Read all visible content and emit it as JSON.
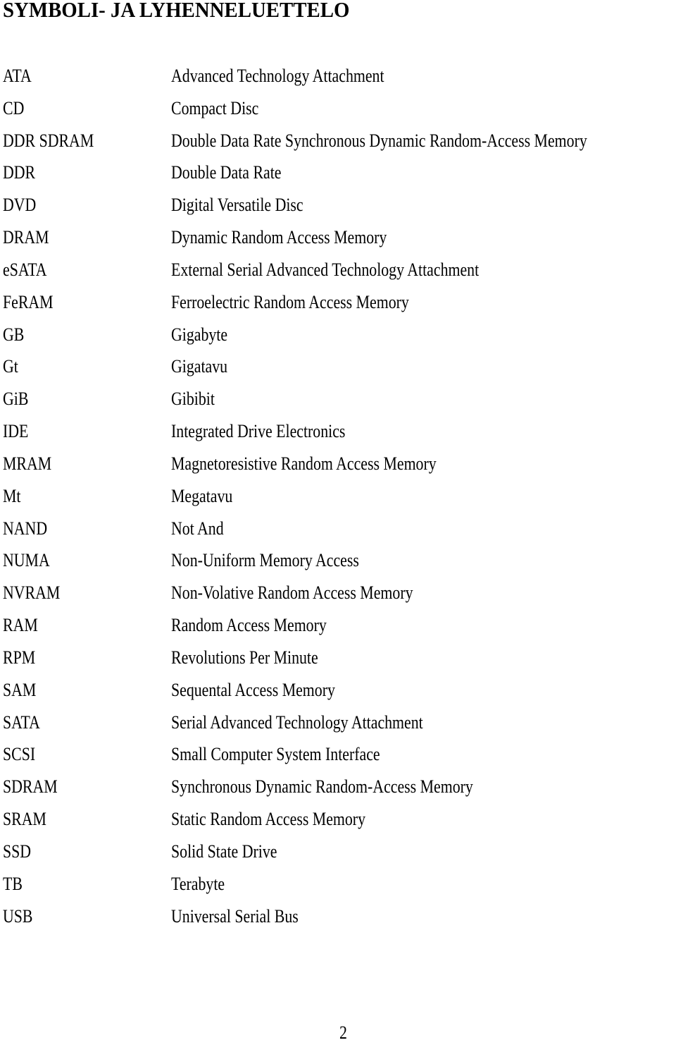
{
  "document": {
    "title": "SYMBOLI- JA LYHENNELUETTELO",
    "page_number": "2"
  },
  "abbreviations": [
    {
      "abbr": "ATA",
      "definition": "Advanced Technology Attachment"
    },
    {
      "abbr": "CD",
      "definition": "Compact Disc"
    },
    {
      "abbr": "DDR SDRAM",
      "definition": "Double Data Rate Synchronous Dynamic Random-Access Memory"
    },
    {
      "abbr": "DDR",
      "definition": "Double Data Rate"
    },
    {
      "abbr": "DVD",
      "definition": "Digital Versatile Disc"
    },
    {
      "abbr": "DRAM",
      "definition": "Dynamic Random Access Memory"
    },
    {
      "abbr": "eSATA",
      "definition": "External Serial Advanced Technology Attachment"
    },
    {
      "abbr": "FeRAM",
      "definition": "Ferroelectric Random Access Memory"
    },
    {
      "abbr": "GB",
      "definition": "Gigabyte"
    },
    {
      "abbr": "Gt",
      "definition": "Gigatavu"
    },
    {
      "abbr": "GiB",
      "definition": "Gibibit"
    },
    {
      "abbr": "IDE",
      "definition": "Integrated Drive Electronics"
    },
    {
      "abbr": "MRAM",
      "definition": "Magnetoresistive Random Access Memory"
    },
    {
      "abbr": "Mt",
      "definition": "Megatavu"
    },
    {
      "abbr": "NAND",
      "definition": "Not And"
    },
    {
      "abbr": "NUMA",
      "definition": "Non-Uniform Memory Access"
    },
    {
      "abbr": "NVRAM",
      "definition": "Non-Volative Random Access Memory"
    },
    {
      "abbr": "RAM",
      "definition": "Random Access Memory"
    },
    {
      "abbr": "RPM",
      "definition": "Revolutions Per Minute"
    },
    {
      "abbr": "SAM",
      "definition": "Sequental Access Memory"
    },
    {
      "abbr": "SATA",
      "definition": "Serial Advanced Technology Attachment"
    },
    {
      "abbr": "SCSI",
      "definition": "Small Computer System Interface"
    },
    {
      "abbr": "SDRAM",
      "definition": "Synchronous Dynamic Random-Access Memory"
    },
    {
      "abbr": "SRAM",
      "definition": "Static Random Access Memory"
    },
    {
      "abbr": "SSD",
      "definition": "Solid State Drive"
    },
    {
      "abbr": "TB",
      "definition": "Terabyte"
    },
    {
      "abbr": "USB",
      "definition": "Universal Serial Bus"
    }
  ]
}
